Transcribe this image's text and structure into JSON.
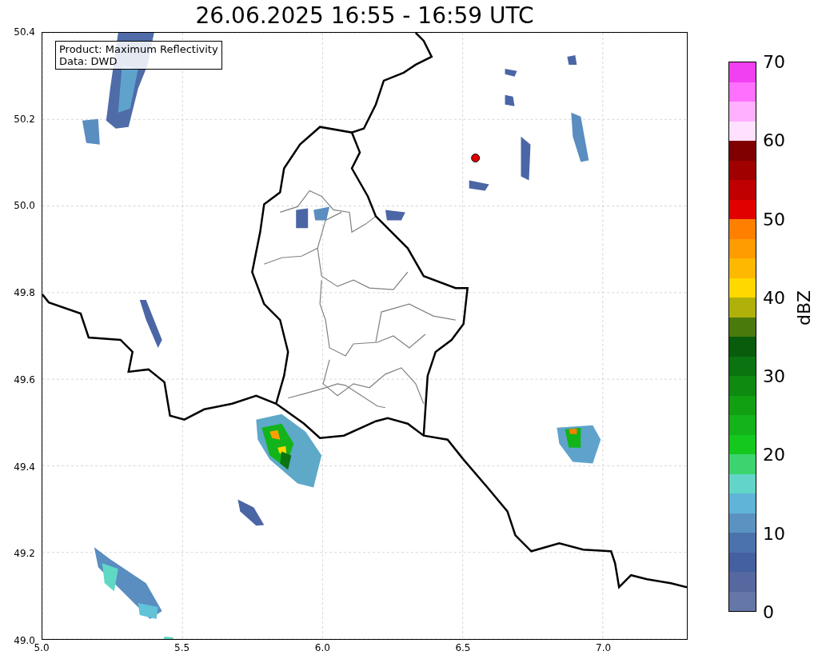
{
  "title": "26.06.2025 16:55 - 16:59 UTC",
  "map": {
    "legend": [
      "Product: Maximum Reflectivity",
      "Data: DWD"
    ],
    "xticks": [
      "5.0",
      "5.5",
      "6.0",
      "6.5",
      "7.0"
    ],
    "yticks": [
      "50.4",
      "50.2",
      "50.0",
      "49.8",
      "49.6",
      "49.4",
      "49.2",
      "49.0"
    ]
  },
  "colorbar": {
    "label": "dBZ",
    "ticks": [
      "70",
      "60",
      "50",
      "40",
      "30",
      "20",
      "10",
      "0"
    ],
    "bins": [
      {
        "color": "#6577a8"
      },
      {
        "color": "#55689f"
      },
      {
        "color": "#4560a0"
      },
      {
        "color": "#4b72ad"
      },
      {
        "color": "#5a93c2"
      },
      {
        "color": "#60b4d8"
      },
      {
        "color": "#62d5c8"
      },
      {
        "color": "#3cd46e"
      },
      {
        "color": "#15c81e"
      },
      {
        "color": "#12b41a"
      },
      {
        "color": "#10a012"
      },
      {
        "color": "#0e8a10"
      },
      {
        "color": "#0b7410"
      },
      {
        "color": "#085c0c"
      },
      {
        "color": "#4a7a0c"
      },
      {
        "color": "#b0b00a"
      },
      {
        "color": "#ffd800"
      },
      {
        "color": "#ffb800"
      },
      {
        "color": "#ff9c00"
      },
      {
        "color": "#ff8000"
      },
      {
        "color": "#e00000"
      },
      {
        "color": "#c00000"
      },
      {
        "color": "#a00000"
      },
      {
        "color": "#800000"
      },
      {
        "color": "#ffe0ff"
      },
      {
        "color": "#ffb0ff"
      },
      {
        "color": "#ff70ff"
      },
      {
        "color": "#f040f0"
      }
    ]
  }
}
